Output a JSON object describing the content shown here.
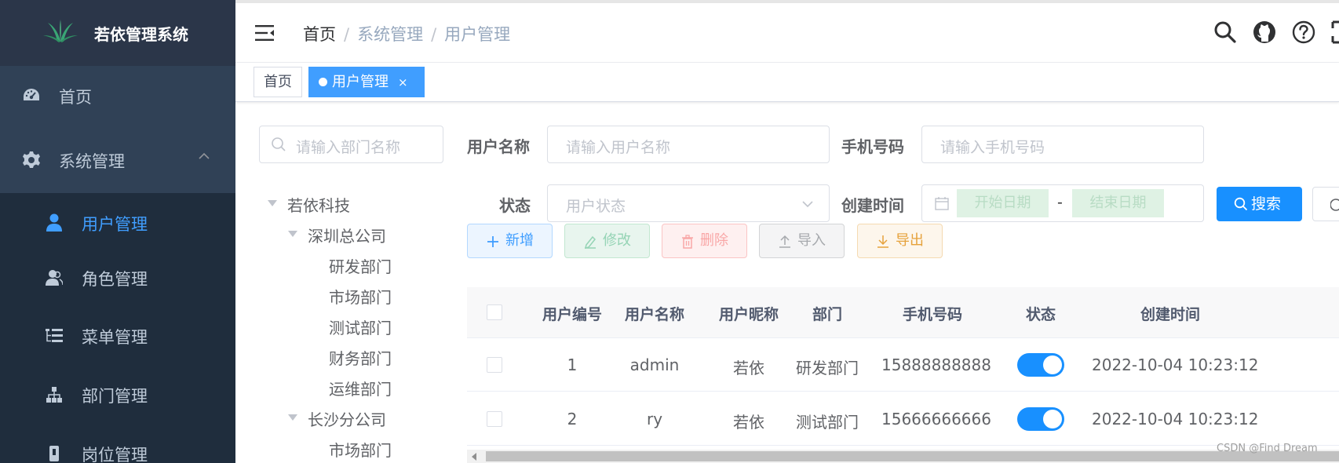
{
  "sidebar": {
    "logo_title": "若依管理系统",
    "menu": [
      {
        "label": "首页",
        "icon": "dashboard-icon"
      },
      {
        "label": "系统管理",
        "icon": "gear-icon",
        "expanded": true
      }
    ],
    "submenu": [
      {
        "label": "用户管理",
        "icon": "user-icon",
        "active": true
      },
      {
        "label": "角色管理",
        "icon": "peoples-icon"
      },
      {
        "label": "菜单管理",
        "icon": "tree-table-icon"
      },
      {
        "label": "部门管理",
        "icon": "tree-icon"
      },
      {
        "label": "岗位管理",
        "icon": "post-icon"
      }
    ]
  },
  "header": {
    "breadcrumb": [
      "首页",
      "系统管理",
      "用户管理"
    ],
    "separator": "/"
  },
  "tags": {
    "items": [
      {
        "label": "首页",
        "active": false
      },
      {
        "label": "用户管理",
        "active": true,
        "close": "×"
      }
    ]
  },
  "dept_tree": {
    "search_placeholder": "请输入部门名称",
    "nodes": [
      {
        "label": "若依科技",
        "level": 0,
        "expanded": true
      },
      {
        "label": "深圳总公司",
        "level": 1,
        "expanded": true
      },
      {
        "label": "研发部门",
        "level": 2
      },
      {
        "label": "市场部门",
        "level": 2
      },
      {
        "label": "测试部门",
        "level": 2
      },
      {
        "label": "财务部门",
        "level": 2
      },
      {
        "label": "运维部门",
        "level": 2
      },
      {
        "label": "长沙分公司",
        "level": 1,
        "expanded": true
      },
      {
        "label": "市场部门",
        "level": 2
      }
    ]
  },
  "query_form": {
    "username_label": "用户名称",
    "username_placeholder": "请输入用户名称",
    "phone_label": "手机号码",
    "phone_placeholder": "请输入手机号码",
    "status_label": "状态",
    "status_placeholder": "用户状态",
    "create_time_label": "创建时间",
    "start_date_placeholder": "开始日期",
    "date_separator": "-",
    "end_date_placeholder": "结束日期",
    "search_button": "搜索"
  },
  "toolbar": {
    "add": "新增",
    "edit": "修改",
    "delete": "删除",
    "import": "导入",
    "export": "导出"
  },
  "table": {
    "columns": [
      "用户编号",
      "用户名称",
      "用户昵称",
      "部门",
      "手机号码",
      "状态",
      "创建时间"
    ],
    "rows": [
      {
        "id": "1",
        "username": "admin",
        "nickname": "若依",
        "dept": "研发部门",
        "phone": "15888888888",
        "status_on": true,
        "create_time": "2022-10-04 10:23:12"
      },
      {
        "id": "2",
        "username": "ry",
        "nickname": "若依",
        "dept": "测试部门",
        "phone": "15666666666",
        "status_on": true,
        "create_time": "2022-10-04 10:23:12"
      }
    ]
  },
  "watermark": "CSDN @Find Dream",
  "colors": {
    "sidebar_bg": "#304156",
    "submenu_bg": "#1f2d3d",
    "primary": "#409eff",
    "search_button": "#1890ff"
  }
}
